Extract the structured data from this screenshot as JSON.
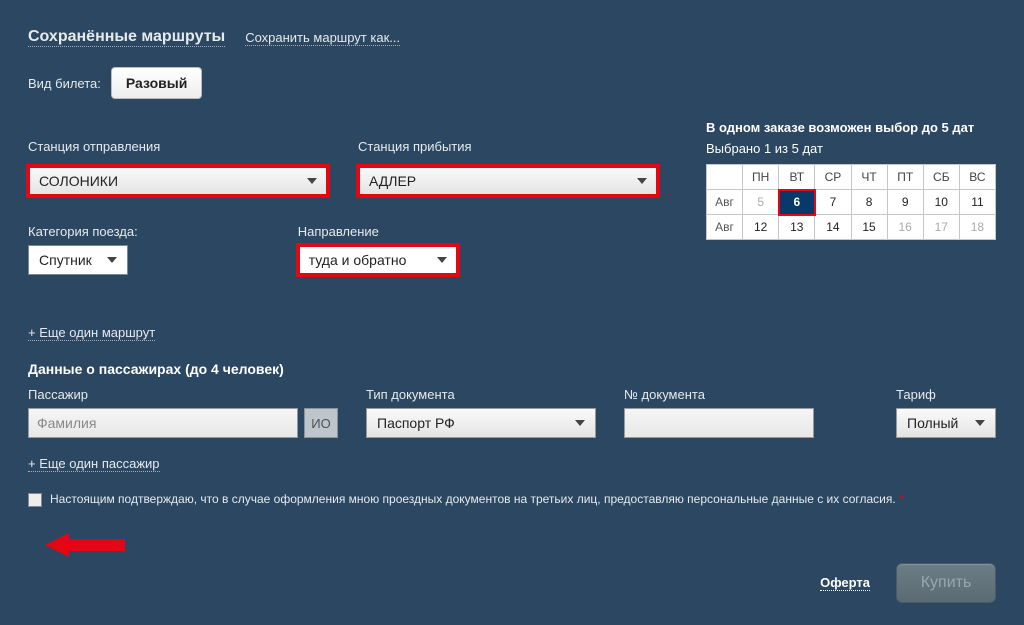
{
  "topbar": {
    "saved_routes": "Сохранённые маршруты",
    "save_as": "Сохранить маршрут как..."
  },
  "ticket": {
    "label": "Вид билета:",
    "value": "Разовый"
  },
  "station": {
    "departure_label": "Станция отправления",
    "departure_value": "СОЛОНИКИ",
    "arrival_label": "Станция прибытия",
    "arrival_value": "АДЛЕР"
  },
  "category": {
    "label": "Категория поезда:",
    "value": "Спутник"
  },
  "direction": {
    "label": "Направление",
    "value": "туда и обратно"
  },
  "calendar": {
    "note": "В одном заказе возможен выбор до 5 дат",
    "selected": "Выбрано 1 из 5 дат",
    "weekdays": [
      "ПН",
      "ВТ",
      "СР",
      "ЧТ",
      "ПТ",
      "СБ",
      "ВС"
    ],
    "month": "Авг",
    "row1": [
      "5",
      "6",
      "7",
      "8",
      "9",
      "10",
      "11"
    ],
    "row2": [
      "12",
      "13",
      "14",
      "15",
      "16",
      "17",
      "18"
    ]
  },
  "links": {
    "add_route": "+ Еще один маршрут",
    "add_pax": "+ Еще один пассажир"
  },
  "pax": {
    "title": "Данные о пассажирах (до 4 человек)",
    "surname_label": "Пассажир",
    "surname_placeholder": "Фамилия",
    "io": "ИО",
    "doc_type_label": "Тип документа",
    "doc_type_value": "Паспорт РФ",
    "doc_num_label": "№ документа",
    "tariff_label": "Тариф",
    "tariff_value": "Полный"
  },
  "consent": {
    "text": "Настоящим подтверждаю, что в случае оформления мною проездных документов на третьих лиц, предоставляю персональные данные с их согласия.",
    "star": "*"
  },
  "footer": {
    "offer": "Оферта",
    "buy": "Купить"
  }
}
